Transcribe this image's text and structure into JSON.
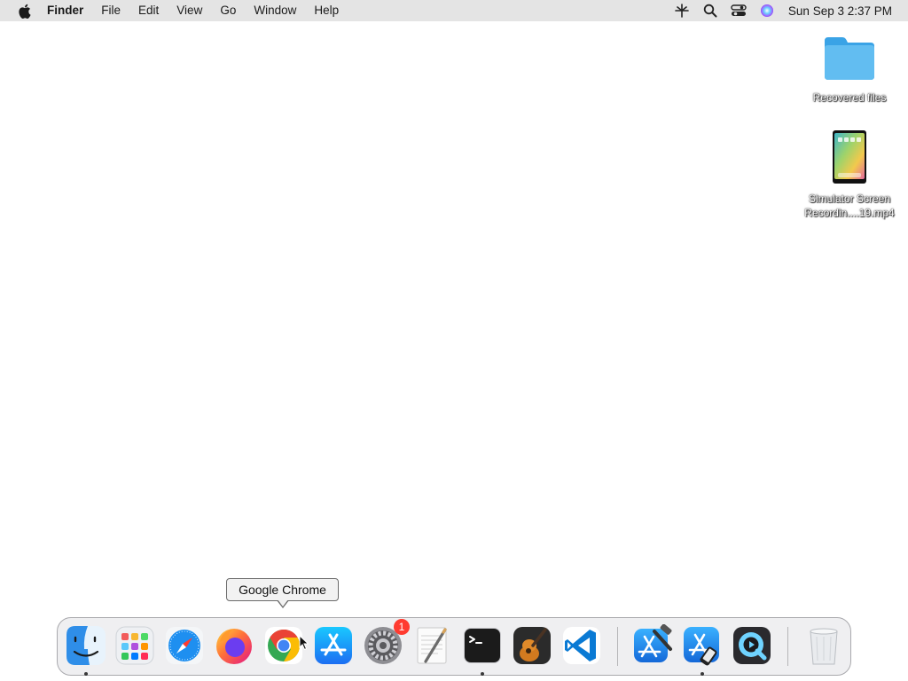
{
  "menubar": {
    "app_name": "Finder",
    "items": [
      "File",
      "Edit",
      "View",
      "Go",
      "Window",
      "Help"
    ],
    "clock": "Sun Sep 3  2:37 PM",
    "status_icons": [
      "network-icon",
      "spotlight-search-icon",
      "control-center-icon",
      "siri-icon"
    ]
  },
  "desktop": {
    "icons": [
      {
        "label": "Recovered files",
        "icon": "folder-icon"
      },
      {
        "label_line1": "Simulator Screen",
        "label_line2": "Recordin....19.mp4",
        "icon": "video-file-icon"
      }
    ]
  },
  "tooltip": {
    "text": "Google Chrome"
  },
  "dock": {
    "apps": [
      {
        "name": "Finder",
        "icon": "finder-icon",
        "running": true
      },
      {
        "name": "Launchpad",
        "icon": "launchpad-icon",
        "running": false
      },
      {
        "name": "Safari",
        "icon": "safari-icon",
        "running": false
      },
      {
        "name": "Firefox",
        "icon": "firefox-icon",
        "running": false
      },
      {
        "name": "Google Chrome",
        "icon": "chrome-icon",
        "running": false
      },
      {
        "name": "App Store",
        "icon": "app-store-icon",
        "running": false
      },
      {
        "name": "System Settings",
        "icon": "system-settings-icon",
        "running": false,
        "badge": "1"
      },
      {
        "name": "TextEdit",
        "icon": "textedit-icon",
        "running": false
      },
      {
        "name": "Terminal",
        "icon": "terminal-icon",
        "running": true
      },
      {
        "name": "GarageBand",
        "icon": "garageband-icon",
        "running": false
      },
      {
        "name": "Visual Studio Code",
        "icon": "vscode-icon",
        "running": false
      },
      {
        "name": "Xcode",
        "icon": "xcode-icon",
        "running": false
      },
      {
        "name": "Simulator",
        "icon": "simulator-icon",
        "running": true
      },
      {
        "name": "QuickTime Player",
        "icon": "quicktime-icon",
        "running": false
      },
      {
        "name": "Trash",
        "icon": "trash-icon",
        "running": false
      }
    ]
  },
  "colors": {
    "menubar_bg": "#e4e4e4",
    "desktop_bg": "#ffffff",
    "folder_blue": "#5fb8ee",
    "badge_red": "#ff3b30"
  }
}
